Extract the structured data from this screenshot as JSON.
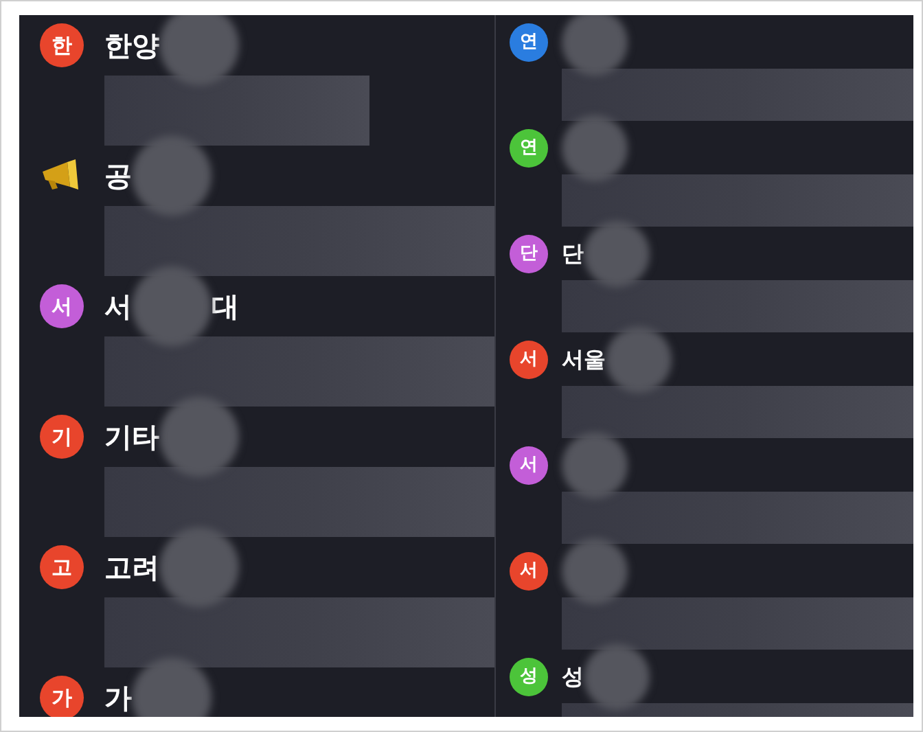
{
  "columns": [
    {
      "rows": [
        {
          "kind": "bubble",
          "badge": "한",
          "color": "#e8452c",
          "title_parts": [
            "한양"
          ],
          "preview_wide": false
        },
        {
          "kind": "megaphone",
          "title_parts": [
            "공"
          ],
          "preview_wide": true
        },
        {
          "kind": "bubble",
          "badge": "서",
          "color": "#c35ed8",
          "title_parts": [
            "서",
            "대"
          ],
          "preview_wide": true
        },
        {
          "kind": "bubble",
          "badge": "기",
          "color": "#e8452c",
          "title_parts": [
            "기타"
          ],
          "preview_wide": true
        },
        {
          "kind": "bubble",
          "badge": "고",
          "color": "#e8452c",
          "title_parts": [
            "고려"
          ],
          "preview_wide": true
        },
        {
          "kind": "bubble",
          "badge": "가",
          "color": "#e8452c",
          "title_parts": [
            "가"
          ]
        }
      ]
    },
    {
      "rows": [
        {
          "kind": "bubble",
          "badge": "연",
          "color": "#2a7de0",
          "preview_wide": true
        },
        {
          "kind": "bubble",
          "badge": "연",
          "color": "#4cc43a",
          "preview_wide": true
        },
        {
          "kind": "bubble",
          "badge": "단",
          "color": "#c35ed8",
          "title_parts": [
            "단"
          ],
          "preview_wide": true
        },
        {
          "kind": "bubble",
          "badge": "서",
          "color": "#e8452c",
          "title_parts": [
            "서울"
          ],
          "preview_wide": true
        },
        {
          "kind": "bubble",
          "badge": "서",
          "color": "#c35ed8",
          "preview_wide": true
        },
        {
          "kind": "bubble",
          "badge": "서",
          "color": "#e8452c",
          "preview_wide": true
        },
        {
          "kind": "bubble",
          "badge": "성",
          "color": "#4cc43a",
          "title_parts": [
            "성"
          ],
          "preview_wide": true
        }
      ]
    }
  ]
}
